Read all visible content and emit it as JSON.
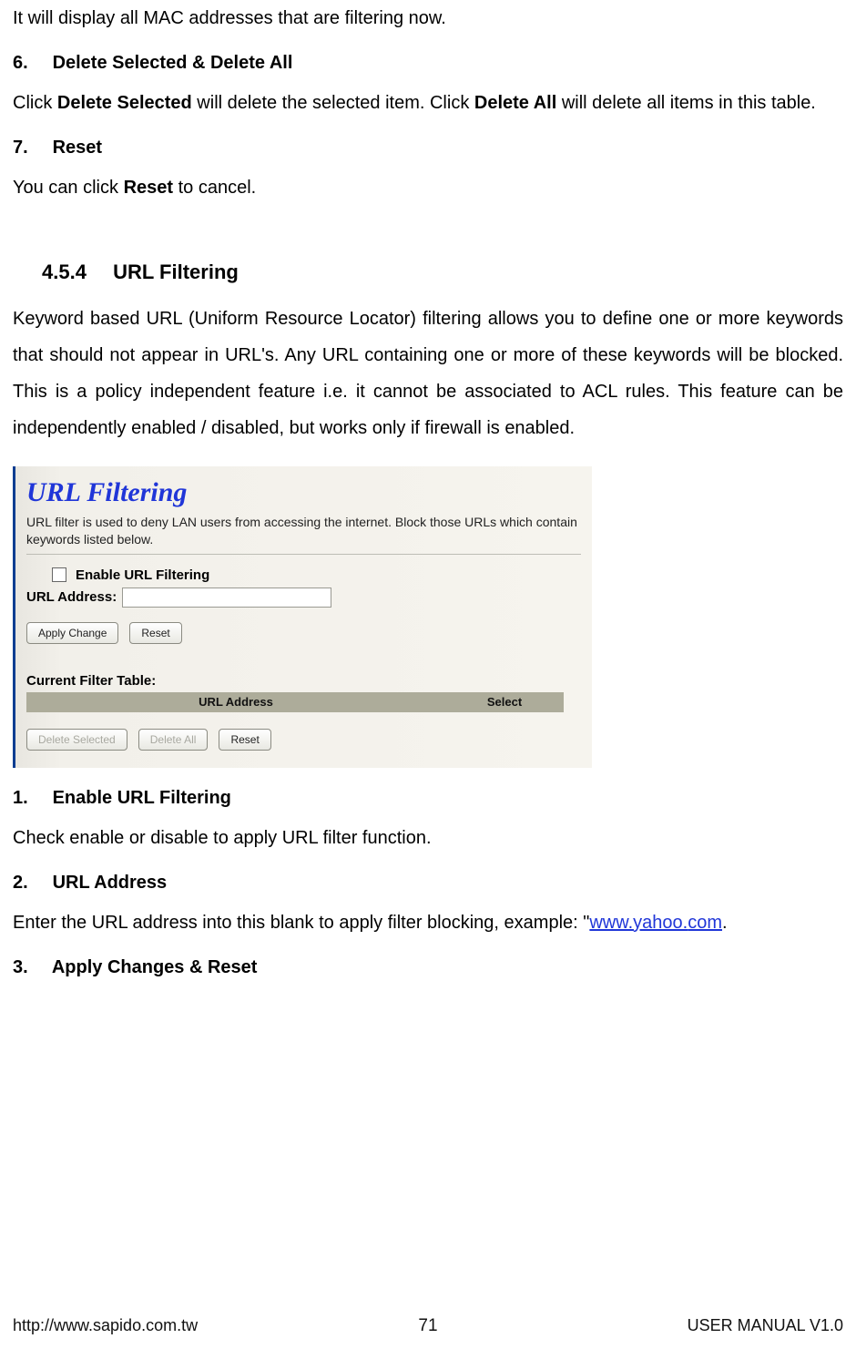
{
  "intro_line": "It will display all MAC addresses that are filtering now.",
  "sec6": {
    "num": "6.",
    "title": "Delete Selected & Delete All",
    "p_a": "Click ",
    "p_b1": "Delete Selected",
    "p_c": " will delete the selected item. Click ",
    "p_b2": "Delete All",
    "p_d": " will delete all items in this table."
  },
  "sec7": {
    "num": "7.",
    "title": "Reset",
    "p_a": "You can click ",
    "p_b": "Reset",
    "p_c": " to cancel."
  },
  "s454": {
    "num": "4.5.4",
    "title": "URL Filtering",
    "body": "Keyword based URL (Uniform Resource Locator) filtering allows you to define one or more keywords that should not appear in URL's. Any URL containing one or more of these keywords will be blocked. This is a policy independent feature i.e. it cannot be associated to ACL rules. This feature can be independently enabled / disabled, but works only if firewall is enabled."
  },
  "screenshot": {
    "title": "URL Filtering",
    "desc": "URL filter is used to deny LAN users from accessing the internet. Block those URLs which contain keywords listed below.",
    "enable_label": "Enable URL Filtering",
    "addr_label": "URL Address:",
    "apply_btn": "Apply Change",
    "reset_btn": "Reset",
    "table_title": "Current Filter Table:",
    "col_url": "URL Address",
    "col_sel": "Select",
    "del_sel_btn": "Delete Selected",
    "del_all_btn": "Delete All",
    "reset2_btn": "Reset"
  },
  "sub1": {
    "num": "1.",
    "title": "Enable URL Filtering",
    "body": "Check enable or disable to apply URL filter function."
  },
  "sub2": {
    "num": "2.",
    "title": "URL Address",
    "p_a": "Enter the URL address into this blank to apply filter blocking, example: \"",
    "link1": "www.yahoo.",
    "link2": "com",
    "p_b": "."
  },
  "sub3": {
    "num": "3.",
    "title": "Apply Changes & Reset"
  },
  "footer": {
    "left": "http://www.sapido.com.tw",
    "page": "71",
    "right": "USER MANUAL V1.0"
  }
}
